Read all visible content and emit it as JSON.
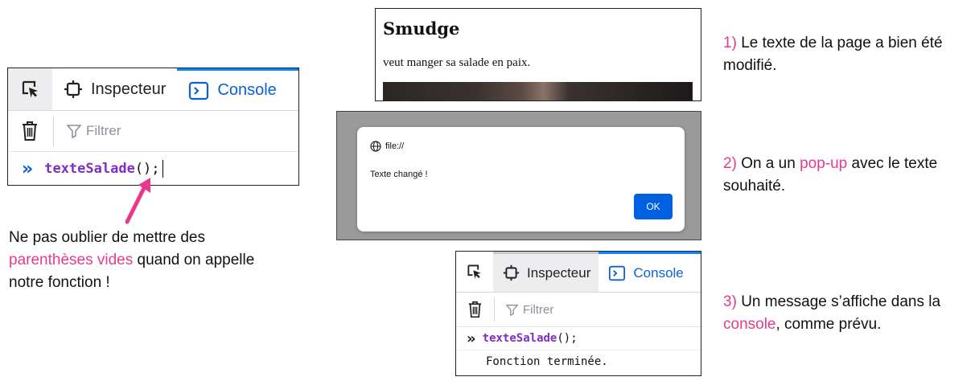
{
  "devtools_top": {
    "tabs": {
      "inspector_label": "Inspecteur",
      "console_label": "Console"
    },
    "toolbar": {
      "filter_placeholder": "Filtrer"
    },
    "input_line": {
      "prompt": "»",
      "function_name": "texteSalade",
      "suffix": "();"
    }
  },
  "webpage": {
    "title": "Smudge",
    "text": "veut manger sa salade en paix."
  },
  "alert": {
    "origin": "file://",
    "message": "Texte changé !",
    "ok_label": "OK"
  },
  "devtools_bottom": {
    "tabs": {
      "inspector_label": "Inspecteur",
      "console_label": "Console"
    },
    "toolbar": {
      "filter_placeholder": "Filtrer"
    },
    "input_line": {
      "prompt": "»",
      "function_name": "texteSalade",
      "suffix": "();"
    },
    "output_line": "Fonction terminée."
  },
  "notes": {
    "note1": {
      "number": "1)",
      "text": "Le texte de la page a bien été modifié."
    },
    "note2": {
      "number": "2)",
      "text_before": "On a un",
      "highlight": "pop-up",
      "text_after": "avec le texte souhaité."
    },
    "note3": {
      "number": "3)",
      "text_before": "Un message s’affiche dans la",
      "highlight": "console",
      "text_after": ", comme prévu."
    },
    "bottom": {
      "text_before": "Ne pas oublier de mettre des",
      "highlight": "parenthèses vides",
      "text_after": "quand on appelle notre fonction !"
    }
  },
  "colors": {
    "accent_pink": "#e8398e",
    "devtools_blue": "#0a84ff",
    "function_purple": "#7e2ec2",
    "alert_button": "#0061e0"
  },
  "icons": [
    "element-picker-icon",
    "inspector-icon",
    "console-icon",
    "trash-icon",
    "filter-icon",
    "globe-icon",
    "arrow-icon"
  ]
}
